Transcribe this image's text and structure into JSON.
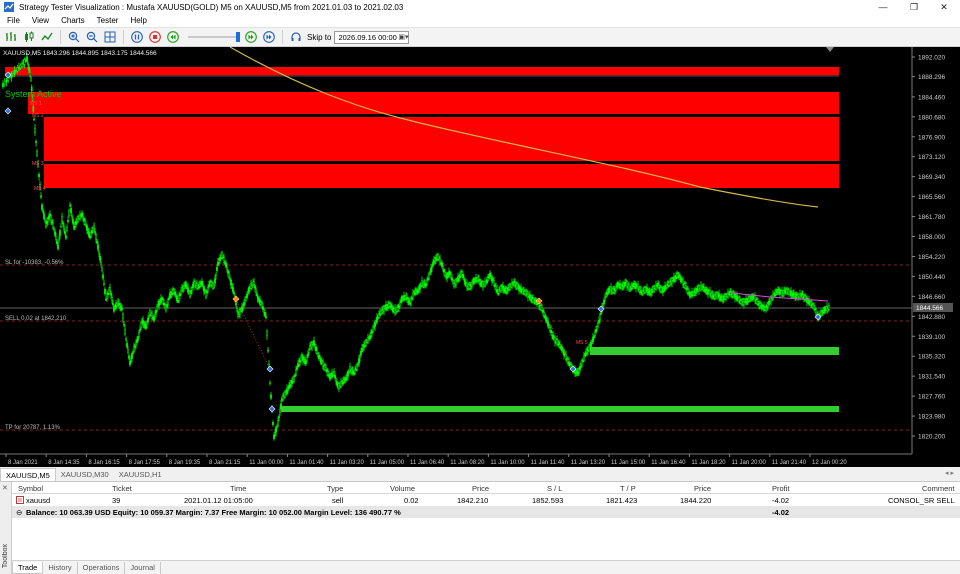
{
  "window": {
    "title": "Strategy Tester Visualization : Mustafa XAUUSD(GOLD) M5 on XAUUSD,M5 from 2021.01.03 to 2021.02.03",
    "minimize": "—",
    "maximize": "❐",
    "close": "✕"
  },
  "menu": [
    "File",
    "View",
    "Charts",
    "Tester",
    "Help"
  ],
  "toolbar": {
    "skip_label": "Skip to",
    "skip_date": "2026.09.16 00:00",
    "speed_level_fraction": 0.95
  },
  "chart": {
    "header": "XAUUSD,M5  1843.296 1844.895 1843.175 1844.566",
    "status_label": "System Active",
    "sl_label": "SL for -10383, -0.56%",
    "sell_label": "SELL 0.02 at 1842.210",
    "tp_label": "TP for 20787, 1.13%",
    "current_price": "1844.566",
    "price_ticks": [
      "1892.020",
      "1888.296",
      "1884.460",
      "1880.680",
      "1876.900",
      "1873.120",
      "1869.340",
      "1865.560",
      "1861.780",
      "1858.000",
      "1854.220",
      "1850.440",
      "1846.660",
      "1842.880",
      "1839.100",
      "1835.320",
      "1831.540",
      "1827.760",
      "1823.980",
      "1820.200"
    ],
    "time_ticks": [
      "8 Jan 2021",
      "8 Jan 14:35",
      "8 Jan 16:15",
      "8 Jan 17:55",
      "8 Jan 19:35",
      "8 Jan 21:15",
      "11 Jan 00:00",
      "11 Jan 01:40",
      "11 Jan 03:20",
      "11 Jan 05:00",
      "11 Jan 06:40",
      "11 Jan 08:20",
      "11 Jan 10:00",
      "11 Jan 11:40",
      "11 Jan 13:20",
      "11 Jan 15:00",
      "11 Jan 16:40",
      "11 Jan 18:20",
      "11 Jan 20:00",
      "11 Jan 21:40",
      "12 Jan 00:20"
    ],
    "small_labels": [
      "MS 1",
      "MS 2",
      "MS 3",
      "MS 4",
      "MS 5"
    ],
    "colors": {
      "bull": "#00ff00",
      "bear": "#00ff00",
      "resistance": "#ff0000",
      "support": "#33cc33",
      "ma": "#d4b84a",
      "status": "#00cc00"
    }
  },
  "chart_tabs": [
    "XAUUSD,M5",
    "XAUUSD,M30",
    "XAUUSD,H1"
  ],
  "toolbox": {
    "label": "Toolbox",
    "columns": [
      "Symbol",
      "Ticket",
      "Time",
      "Type",
      "Volume",
      "Price",
      "S / L",
      "T / P",
      "Price",
      "Profit",
      "Comment"
    ],
    "rows": [
      {
        "symbol": "xauusd",
        "ticket": "39",
        "time": "2021.01.12 01:05:00",
        "type": "sell",
        "volume": "0.02",
        "price": "1842.210",
        "sl": "1852.593",
        "tp": "1821.423",
        "price2": "1844.220",
        "profit": "-4.02",
        "comment": "CONSOL_SR SELL"
      }
    ],
    "balance": "Balance: 10 063.39 USD  Equity: 10 059.37  Margin: 7.37  Free Margin: 10 052.00  Margin Level: 136 490.77 %",
    "balance_profit": "-4.02",
    "tabs": [
      "Trade",
      "History",
      "Operations",
      "Journal"
    ]
  }
}
